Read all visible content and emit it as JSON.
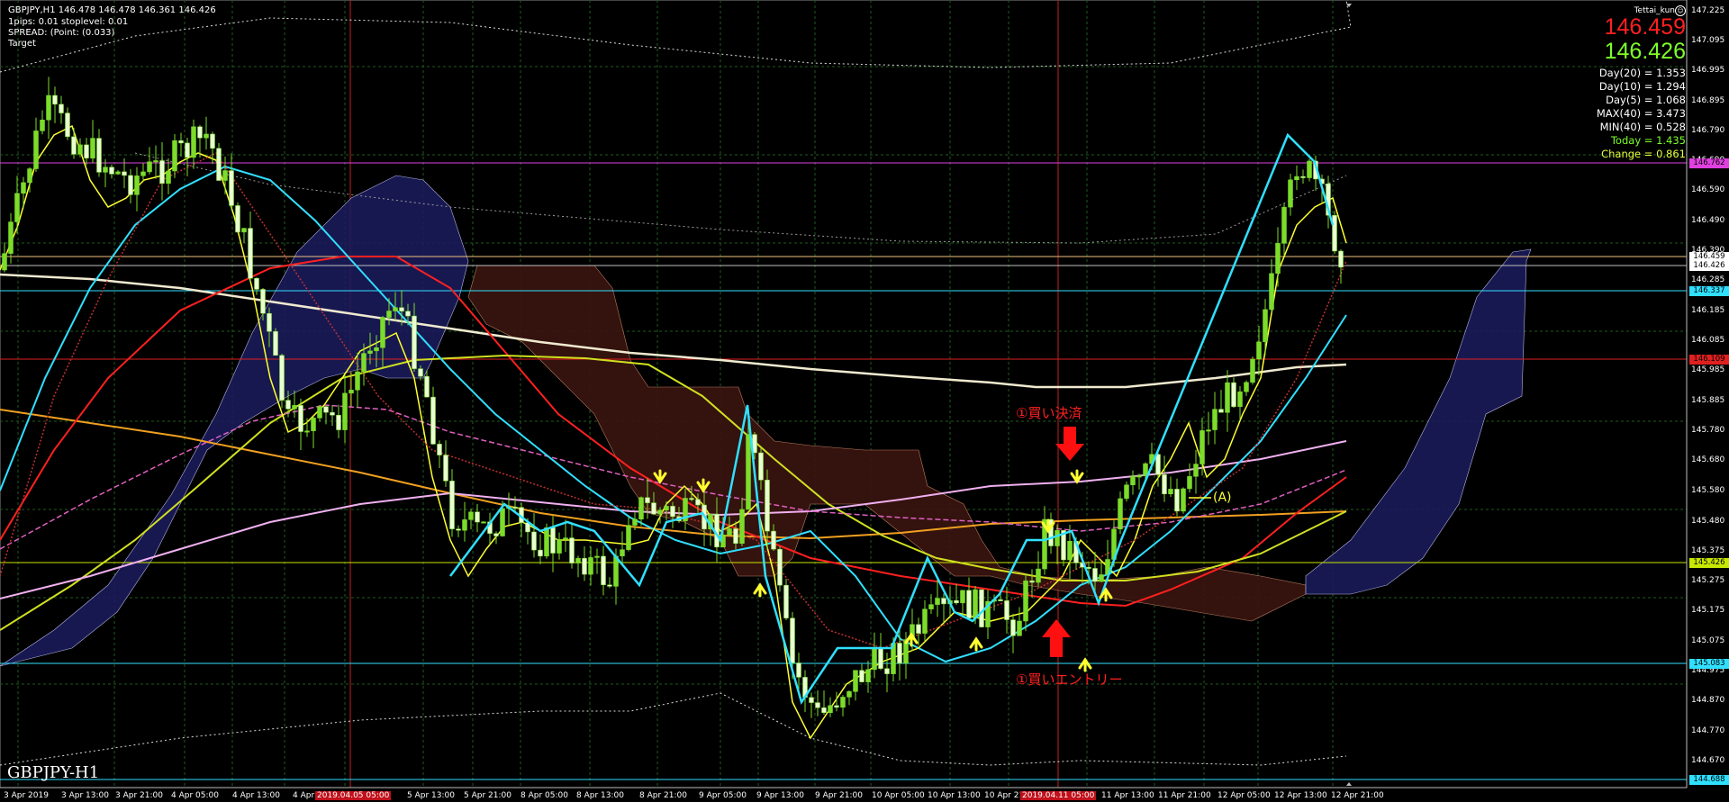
{
  "header": {
    "symbol_line": "GBPJPY,H1  146.478 146.478 146.361 146.426",
    "info_lines": [
      "1pips: 0.01 stoplevel: 0.01",
      "SPREAD: (Point: (0.033)",
      "Target"
    ],
    "author": "Tettai_kun",
    "bid": "146.459",
    "ask": "146.426"
  },
  "stats": [
    {
      "label": "Day(20) = 1.353",
      "color": "#ffffff"
    },
    {
      "label": "Day(10) = 1.294",
      "color": "#ffffff"
    },
    {
      "label": "Day(5) = 1.068",
      "color": "#ffffff"
    },
    {
      "label": "MAX(40) = 3.473",
      "color": "#ffffff"
    },
    {
      "label": "MIN(40) = 0.528",
      "color": "#ffffff"
    },
    {
      "label": "Today = 1.435",
      "color": "#7cff2a"
    },
    {
      "label": "Change = 0.861",
      "color": "#e8ff3a"
    }
  ],
  "colors": {
    "bid": "#ff2020",
    "ask": "#7cff2a",
    "background": "#000000"
  },
  "watermark": "GBPJPY-H1",
  "annotations": {
    "exit": "①買い決済",
    "entry": "①買いエントリー",
    "wave_a": "(A)"
  },
  "y_axis": {
    "ticks": [
      "147.225",
      "147.095",
      "146.995",
      "146.895",
      "146.790",
      "146.690",
      "146.590",
      "146.490",
      "146.390",
      "146.285",
      "146.185",
      "146.085",
      "145.985",
      "145.885",
      "145.780",
      "145.680",
      "145.580",
      "145.480",
      "145.375",
      "145.275",
      "145.175",
      "145.075",
      "144.975",
      "144.870",
      "144.770",
      "144.670"
    ],
    "price_tags": [
      {
        "label": "146.762",
        "bg": "#e040e0"
      },
      {
        "label": "146.459",
        "bg": "#ffffff"
      },
      {
        "label": "146.426",
        "bg": "#ffffff"
      },
      {
        "label": "146.337",
        "bg": "#30e0ff"
      },
      {
        "label": "146.109",
        "bg": "#e02020"
      },
      {
        "label": "145.426",
        "bg": "#c8e800"
      },
      {
        "label": "145.083",
        "bg": "#30e0ff"
      },
      {
        "label": "144.688",
        "bg": "#30e0ff"
      }
    ]
  },
  "x_axis": {
    "labels": [
      "3 Apr 2019",
      "3 Apr 13:00",
      "3 Apr 21:00",
      "4 Apr 05:00",
      "4 Apr 13:00",
      "4 Apr",
      "2019.04.05 05:00",
      "5 Apr 13:00",
      "5 Apr 21:00",
      "8 Apr 05:00",
      "8 Apr 13:00",
      "8 Apr 21:00",
      "9 Apr 05:00",
      "9 Apr 13:00",
      "9 Apr 21:00",
      "10 Apr 05:00",
      "10 Apr 13:00",
      "10 Apr 21:00",
      "2019.04.11 05:00",
      "11 Apr 13:00",
      "11 Apr 21:00",
      "12 Apr 05:00",
      "12 Apr 13:00",
      "12 Apr 21:00"
    ]
  }
}
